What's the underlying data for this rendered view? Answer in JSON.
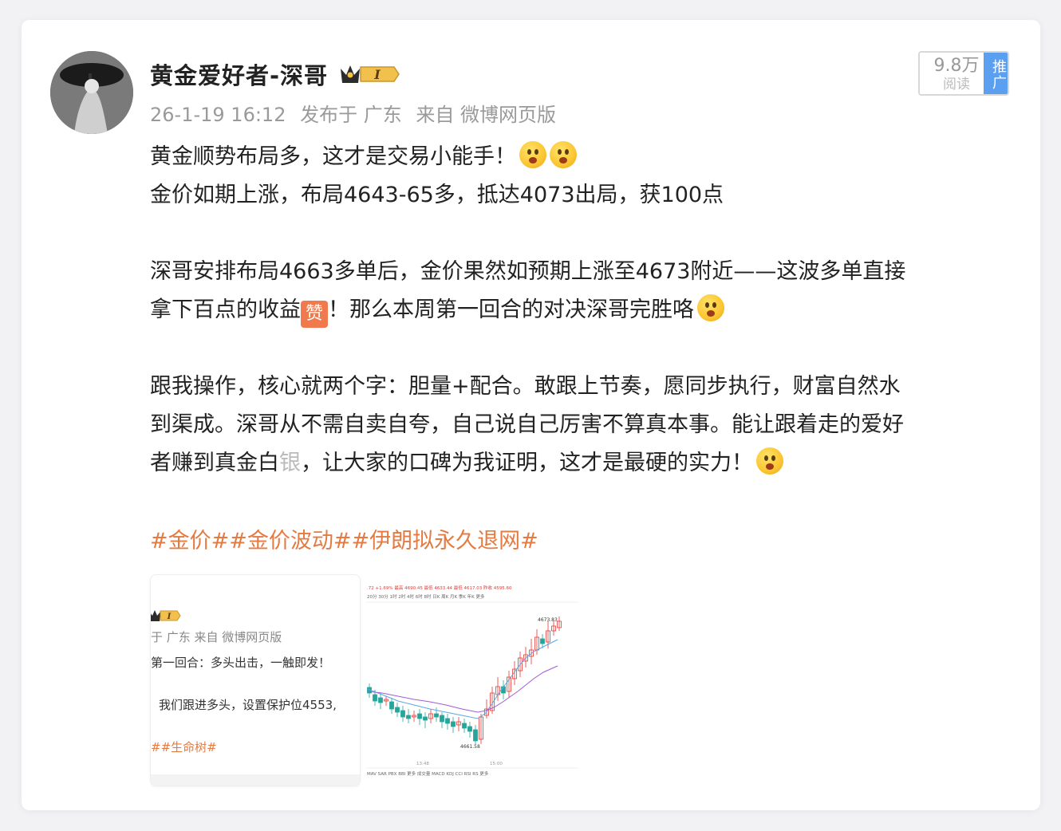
{
  "post": {
    "author": "黄金爱好者-深哥",
    "badge_level": "I",
    "timestamp": "26-1-19 16:12",
    "published_at": "发布于 广东",
    "source": "来自 微博网页版",
    "views": "9.8万",
    "views_label": "阅读",
    "promote_label": "推广",
    "lines": {
      "l1": "黄金顺势布局多，这才是交易小能手！",
      "l2": "金价如期上涨，布局4643-65多，抵达4073出局，获100点",
      "l3a": "深哥安排布局4663多单后，金价果然如预期上涨至4673附近——这波多单直接",
      "l3b": "拿下百点的收益",
      "zan": "赞",
      "l3c": "！那么本周第一回合的对决深哥完胜咯",
      "l4a": "跟我操作，核心就两个字：胆量+配合。敢跟上节奏，愿同步执行，财富自然水",
      "l4b": "到渠成。深哥从不需自卖自夸，自己说自己厉害不算真本事。能让跟着走的爱好",
      "l4c": "者赚到真金白",
      "l4c_cut": "银",
      "l4d": "，让大家的口碑为我证明，这才是最硬的实力！"
    },
    "hashtags": "#金价##金价波动##伊朗拟永久退网#"
  },
  "thumb1": {
    "meta": "于 广东  来自 微博网页版",
    "line1": "第一回合：多头出击，一触即发！",
    "line2": "我们跟进多头，设置保护位4553,",
    "tags": "##生命树#"
  },
  "thumb2": {
    "header": ".72  +1.69%  最高 4690.45  最低 4633.44  最低 4617.03  昨收 4595.60",
    "tabs": "20分  30分  1时  2时  4时  6时  8时  日K  周K  月K  季K  年K  更多",
    "top_label": "4673.83",
    "low_label": "4661.58",
    "time_a": "13:48",
    "time_b": "15:00",
    "indicators": "MAV  SAR  PBX  BBI  更多     成交量  MACD  KDJ  CCI  RSI  RS  更多"
  },
  "colors": {
    "hashtag": "#e47b43",
    "promote": "#5b9ff0",
    "up_candle": "#e53935",
    "down_candle": "#26a69a"
  }
}
